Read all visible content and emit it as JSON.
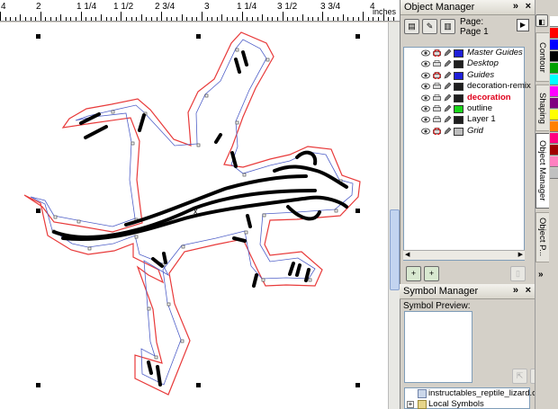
{
  "ruler": {
    "labels": [
      "4",
      "2",
      "1 1/4",
      "1 1/2",
      "2 3/4",
      "3",
      "1 1/4",
      "3 1/2",
      "3 3/4",
      "4"
    ],
    "units": "inches"
  },
  "object_manager": {
    "title": "Object Manager",
    "page_label": "Page:",
    "page_value": "Page 1",
    "layers": [
      {
        "name": "Master Guides",
        "color": "#1f1fd8",
        "style": "italic"
      },
      {
        "name": "Desktop",
        "color": "#1f1f1f",
        "style": "italic"
      },
      {
        "name": "Guides",
        "color": "#1f1fd8",
        "style": "italic"
      },
      {
        "name": "decoration-remix",
        "color": "#1f1f1f",
        "style": "normal"
      },
      {
        "name": "decoration",
        "color": "#1f1f1f",
        "style": "red"
      },
      {
        "name": "outline",
        "color": "#19d619",
        "style": "normal"
      },
      {
        "name": "Layer 1",
        "color": "#1f1f1f",
        "style": "normal"
      },
      {
        "name": "Grid",
        "color": "#bdbdbd",
        "style": "italic"
      }
    ]
  },
  "symbol_manager": {
    "title": "Symbol Manager",
    "preview_label": "Symbol Preview:",
    "items": [
      "instructables_reptile_lizard.cdr",
      "Local Symbols"
    ]
  },
  "side_tabs": [
    "Contour",
    "Shaping",
    "Object Manager",
    "Object P..."
  ],
  "palette": [
    "#ffffff",
    "#ff0000",
    "#0000ff",
    "#000000",
    "#00a000",
    "#00ffff",
    "#ff00ff",
    "#800080",
    "#ffff00",
    "#ff8000",
    "#ff0080",
    "#a00000",
    "#ff80c0",
    "#c0c0c0"
  ],
  "icons": [
    "chevron-double-icon",
    "close-icon",
    "eye-icon",
    "printer-icon",
    "pencil-icon",
    "play-icon",
    "new-layer-icon",
    "new-master-layer-icon",
    "delete-icon",
    "plus-expand-icon"
  ]
}
